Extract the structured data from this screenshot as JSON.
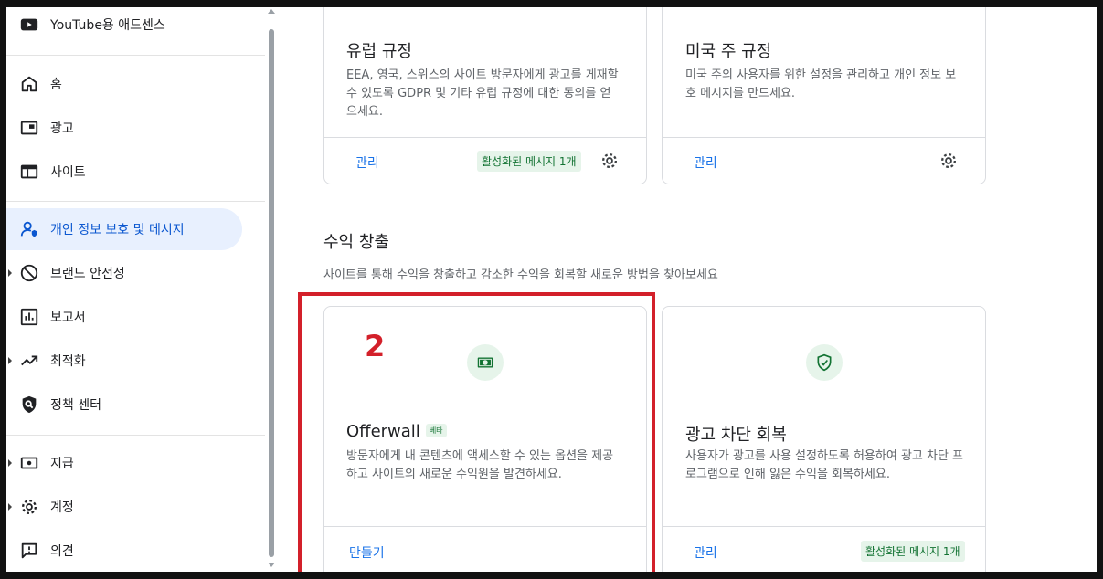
{
  "sidebar": {
    "app_title": "YouTube용 애드센스",
    "items": [
      {
        "label": "홈"
      },
      {
        "label": "광고"
      },
      {
        "label": "사이트"
      },
      {
        "label": "개인 정보 보호 및 메시지"
      },
      {
        "label": "브랜드 안전성"
      },
      {
        "label": "보고서"
      },
      {
        "label": "최적화"
      },
      {
        "label": "정책 센터"
      },
      {
        "label": "지급"
      },
      {
        "label": "계정"
      },
      {
        "label": "의견"
      }
    ]
  },
  "regulations": {
    "eu": {
      "title": "유럽 규정",
      "desc": "EEA, 영국, 스위스의 사이트 방문자에게 광고를 게재할 수 있도록 GDPR 및 기타 유럽 규정에 대한 동의를 얻으세요.",
      "manage": "관리",
      "badge": "활성화된 메시지 1개"
    },
    "us": {
      "title": "미국 주 규정",
      "desc": "미국 주의 사용자를 위한 설정을 관리하고 개인 정보 보호 메시지를 만드세요.",
      "manage": "관리"
    }
  },
  "monetization": {
    "title": "수익 창출",
    "subtitle": "사이트를 통해 수익을 창출하고 감소한 수익을 회복할 새로운 방법을 찾아보세요",
    "step_number": "2",
    "offerwall": {
      "title": "Offerwall",
      "beta": "베타",
      "desc": "방문자에게 내 콘텐츠에 액세스할 수 있는 옵션을 제공하고 사이트의 새로운 수익원을 발견하세요.",
      "create": "만들기"
    },
    "adblock": {
      "title": "광고 차단 회복",
      "desc": "사용자가 광고를 사용 설정하도록 허용하여 광고 차단 프로그램으로 인해 잃은 수익을 회복하세요.",
      "manage": "관리",
      "badge": "활성화된 메시지 1개"
    }
  },
  "colors": {
    "accent": "#1a73e8",
    "active_bg": "#e8f0fe",
    "green_badge_bg": "#e6f4ea",
    "green_text": "#137333",
    "highlight": "#d3202a"
  }
}
